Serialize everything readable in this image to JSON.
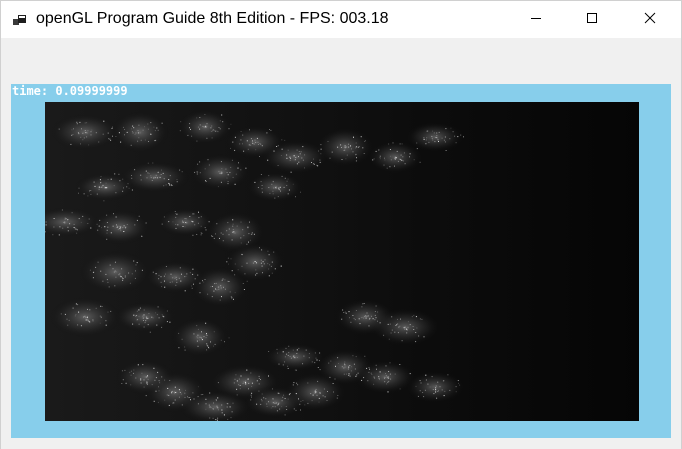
{
  "window": {
    "title": "openGL Program Guide 8th Edition - FPS: 003.18",
    "app_icon": "app-window-icon",
    "controls": {
      "minimize_icon": "minimize-icon",
      "maximize_icon": "maximize-icon",
      "close_icon": "close-icon"
    }
  },
  "viewport": {
    "time_label": "time: 0.09999999",
    "background_color": "#87ceeb",
    "render_background": "#0b0b0b"
  }
}
